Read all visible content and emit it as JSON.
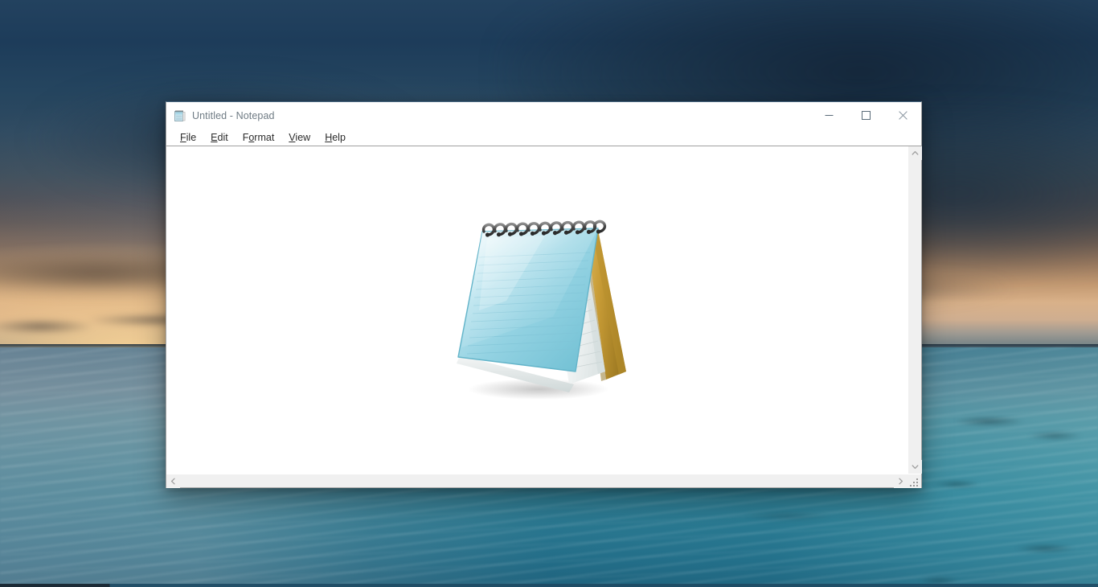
{
  "desktop": {
    "wallpaper_description": "tropical shallow-water seascape at dusk with stormy sky and sunset glow",
    "colors": {
      "sky_dark": "#23425f",
      "sunset_glow": "#d9b189",
      "sea_near": "#5b8193",
      "sea_far": "#1b5e7a",
      "taskbar": "#1d4a63"
    }
  },
  "window": {
    "title": "Untitled - Notepad",
    "title_icon": "notepad-icon",
    "accent_border": "#4a6881",
    "controls": [
      {
        "name": "minimize",
        "glyph": "—",
        "label": "Minimize"
      },
      {
        "name": "maximize",
        "glyph": "☐",
        "label": "Maximize"
      },
      {
        "name": "close",
        "glyph": "✕",
        "label": "Close"
      }
    ],
    "menu": [
      {
        "label": "File",
        "accel_index": 0
      },
      {
        "label": "Edit",
        "accel_index": 0
      },
      {
        "label": "Format",
        "accel_index": 1
      },
      {
        "label": "View",
        "accel_index": 0
      },
      {
        "label": "Help",
        "accel_index": 0
      }
    ],
    "editor": {
      "content": "",
      "placeholder": "",
      "logo": "notepad-logo",
      "background": "#ffffff"
    },
    "scrollbars": {
      "vertical": {
        "up_glyph": "˄",
        "down_glyph": "˅",
        "thumb_visible": false,
        "track_color": "#f0f0f0"
      },
      "horizontal": {
        "left_glyph": "‹",
        "right_glyph": "›",
        "thumb_visible": false,
        "track_color": "#f0f0f0"
      },
      "resize_grip": "resize-grip"
    }
  },
  "logo": {
    "name": "notepad-logo",
    "front_cover_color": "#7fc6d8",
    "page_color": "#f2f4f4",
    "back_cover_color": "#bd9333",
    "spiral_color": "#3c3c3c"
  }
}
